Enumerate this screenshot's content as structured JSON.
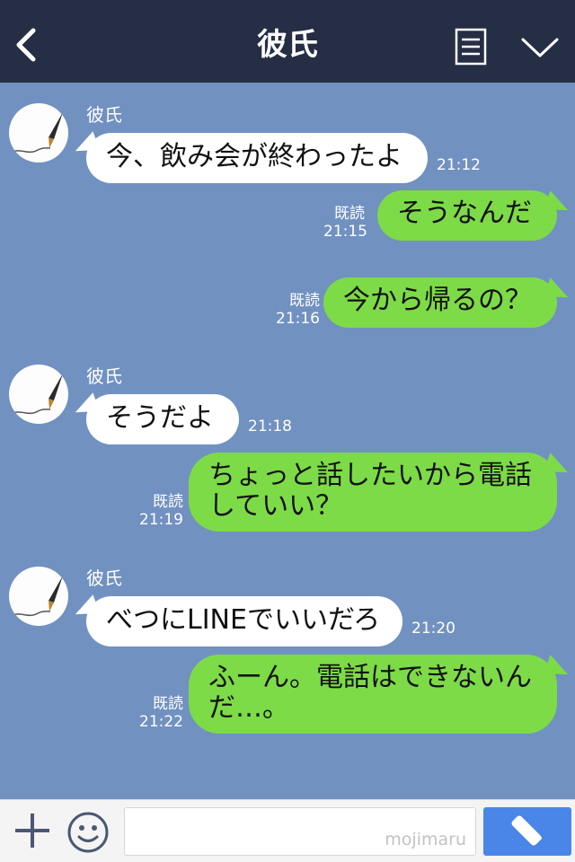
{
  "header": {
    "title": "彼氏"
  },
  "messages": [
    {
      "side": "in",
      "sender": "彼氏",
      "text": "今、飲み会が終わったよ",
      "time": "21:12"
    },
    {
      "side": "out",
      "read": "既読",
      "text": "そうなんだ",
      "time": "21:15"
    },
    {
      "side": "out",
      "read": "既読",
      "text": "今から帰るの？",
      "time": "21:16"
    },
    {
      "side": "in",
      "sender": "彼氏",
      "text": "そうだよ",
      "time": "21:18"
    },
    {
      "side": "out",
      "read": "既読",
      "text_lines": [
        "ちょっと話したいから電話",
        "していい？"
      ],
      "time": "21:19"
    },
    {
      "side": "in",
      "sender": "彼氏",
      "text": "べつにLINEでいいだろ",
      "time": "21:20"
    },
    {
      "side": "out",
      "read": "既読",
      "text_lines": [
        "ふーん。電話はできないん",
        "だ…。"
      ],
      "time": "21:22"
    }
  ],
  "input": {
    "watermark": "mojimaru",
    "value": ""
  },
  "icons": {
    "back": "chevron-left-icon",
    "menu": "document-list-icon",
    "collapse": "chevron-down-icon",
    "plus": "plus-icon",
    "emoji": "smiley-icon",
    "call": "phone-icon"
  },
  "colors": {
    "header_bg": "#262e46",
    "chat_bg": "#7191c1",
    "bubble_in": "#ffffff",
    "bubble_out": "#7ddb47",
    "call_button": "#4a86e8"
  }
}
